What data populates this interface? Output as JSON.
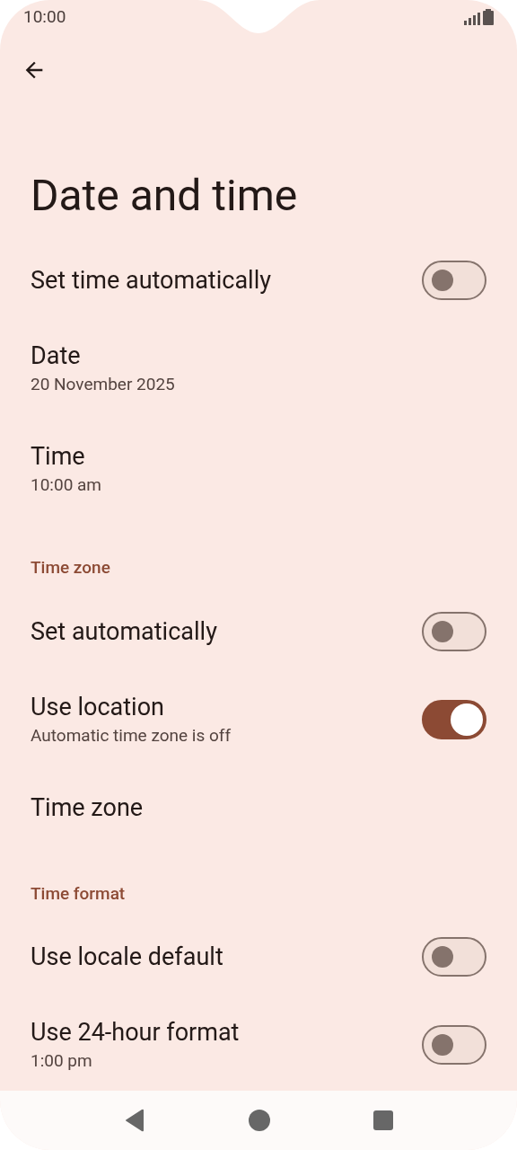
{
  "status_bar": {
    "time": "10:00"
  },
  "title": "Date and time",
  "sections": [
    {
      "rows": [
        {
          "kind": "toggle",
          "title": "Set time automatically",
          "on": false
        },
        {
          "kind": "text",
          "title": "Date",
          "subtitle": "20 November 2025"
        },
        {
          "kind": "text",
          "title": "Time",
          "subtitle": "10:00 am"
        }
      ]
    },
    {
      "header": "Time zone",
      "rows": [
        {
          "kind": "toggle",
          "title": "Set automatically",
          "on": false
        },
        {
          "kind": "toggle",
          "title": "Use location",
          "subtitle": "Automatic time zone is off",
          "on": true
        },
        {
          "kind": "text",
          "title": "Time zone"
        }
      ]
    },
    {
      "header": "Time format",
      "rows": [
        {
          "kind": "toggle",
          "title": "Use locale default",
          "on": false
        },
        {
          "kind": "toggle",
          "title": "Use 24-hour format",
          "subtitle": "1:00 pm",
          "on": false
        }
      ]
    }
  ]
}
